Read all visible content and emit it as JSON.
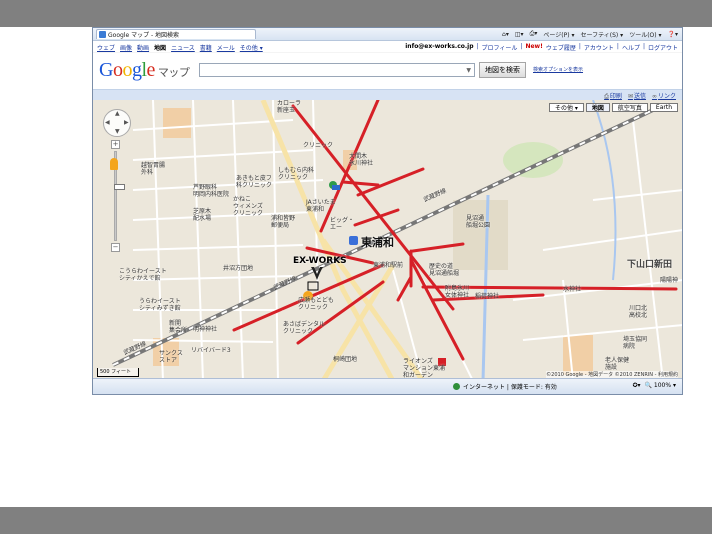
{
  "browser": {
    "tab_title": "Google マップ - 地図検索",
    "commands": [
      "ページ(P) ▾",
      "セーフティ(S) ▾",
      "ツール(O) ▾"
    ]
  },
  "gbar": {
    "links": [
      "ウェブ",
      "画像",
      "動画",
      "地図",
      "ニュース",
      "書籍",
      "メール",
      "その他 ▾"
    ],
    "active_index": 3,
    "email": "info@ex-works.co.jp",
    "right_links": [
      "プロフィール",
      "New!",
      "ウェブ履歴",
      "アカウント",
      "ヘルプ",
      "ログアウト"
    ]
  },
  "search": {
    "logo_letters": [
      "G",
      "o",
      "o",
      "g",
      "l",
      "e"
    ],
    "logo_suffix": "マップ",
    "input_value": "",
    "button_label": "地図を検索",
    "options_link": "検索オプションを表示"
  },
  "subbar": {
    "links": [
      {
        "icon": "print-icon",
        "label": "印刷"
      },
      {
        "icon": "mail-icon",
        "label": "送信"
      },
      {
        "icon": "link-icon",
        "label": "リンク"
      }
    ]
  },
  "map": {
    "types": [
      {
        "label": "その他 ▾",
        "active": false
      },
      {
        "label": "地図",
        "active": true
      },
      {
        "label": "航空写真",
        "active": false
      },
      {
        "label": "Earth",
        "active": false
      }
    ],
    "zoom_level_fraction": 0.6,
    "copyright": "©2010 Google - 地図データ ©2010 ZENRIN - 利用規約",
    "scale": "500 フィート",
    "labels": {
      "karaoke": "カローラ\n新座玉",
      "clinic1": "クリニック",
      "omiya": "大間木\n氷川神社",
      "higashi_urawa": "東浦和",
      "exworks": "EX-WORKS",
      "ja": "JAさいたま\n東浦和",
      "big": "ビッグ・\nエー",
      "hospital1": "越智胃腸\n外科",
      "kinder": "芦野眼科\n明岡内科医院",
      "akimoto": "あきもと皮フ\n科クリニック",
      "shimomura": "しもむら内科\nクリニック",
      "kaneko": "かねこ\nウィメンズ\nクリニック",
      "urawa_clinic": "浦和整形\n外科",
      "minoru": "芝原木\n配水場",
      "kaikyu": "浦和皆野\n郵便局",
      "city_east": "こうらわイースト\nシティかえで館",
      "city_east2": "うらわイースト\nシティみずき館",
      "inui": "井沼方団地",
      "urawa_post": "東浦和駅前",
      "hirose": "広瀬もとども\nクリニック",
      "dental": "あさばデンタル\nクリニック",
      "daimon": "大門神社",
      "hanegi": "見沼通\n船堀公園",
      "mizuno": "水神社",
      "shimoyamaguchi": "下山口新田",
      "yuuhi": "陽陽神",
      "kawaguchi": "川口北\n高校北",
      "kita": "埼玉協同\n病院",
      "rojin": "老人保健\n施設",
      "rekishi": "歴史の道\n見沼通船堀",
      "fuzoku": "附島氷川\n女体神社",
      "hinata": "稲荷神社",
      "myojin": "明神神社",
      "shimizu": "新開\n集会所",
      "riverdent": "リバイバード3",
      "sun": "サンクス\nストア",
      "lions": "ライオンズ\nマンション東浦\n和ガーデン",
      "kirigaya": "桐崎団地",
      "bushino": "武蔵野線",
      "bushino2": "武蔵野線",
      "bushino3": "武蔵野線"
    }
  },
  "status": {
    "zone": "インターネット | 保護モード: 有効",
    "zoom": "100%"
  },
  "colors": {
    "route": "#d62027",
    "road": "#ffffff",
    "major_road": "#f7e3a7",
    "park": "#cfe2b0",
    "water": "#a9c7f0",
    "facility": "#f1cfa6"
  }
}
